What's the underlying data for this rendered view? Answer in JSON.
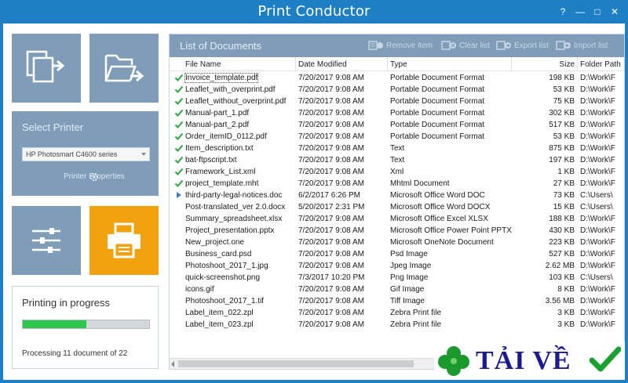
{
  "app": {
    "title": "Print Conductor",
    "help": "?",
    "minimize": "—",
    "maximize": "□",
    "close": "✕"
  },
  "left_panel": {
    "add_files_icon": "add-files-icon",
    "add_folder_icon": "add-folder-icon",
    "select_printer_label": "Select Printer",
    "printer_value": "HP Photosmart C4600 series",
    "printer_properties_label": "Printer Properties",
    "settings_icon": "sliders-icon",
    "print_icon": "printer-icon",
    "accent_color": "#f2a20f",
    "tile_color": "#7f9db8"
  },
  "progress": {
    "title": "Printing in progress",
    "fraction": 0.5,
    "status": "Processing 11 document of 22",
    "bar_color": "#2ec74d"
  },
  "documents": {
    "title": "List of Documents",
    "toolbar": {
      "remove_item": "Remove item",
      "clear_list": "Clear list",
      "export_list": "Export list",
      "import_list": "Import list"
    },
    "columns": {
      "name": "File Name",
      "date": "Date Modified",
      "type": "Type",
      "size": "Size",
      "path": "Folder Path"
    },
    "rows": [
      {
        "status": "done",
        "name": "Invoice_template.pdf",
        "date": "7/20/2017 9:08 AM",
        "type": "Portable Document Format",
        "size": "198 KB",
        "path": "D:\\Work\\F"
      },
      {
        "status": "done",
        "name": "Leaflet_with_overprint.pdf",
        "date": "7/20/2017 9:08 AM",
        "type": "Portable Document Format",
        "size": "53 KB",
        "path": "D:\\Work\\F"
      },
      {
        "status": "done",
        "name": "Leaflet_without_overprint.pdf",
        "date": "7/20/2017 9:08 AM",
        "type": "Portable Document Format",
        "size": "75 KB",
        "path": "D:\\Work\\F"
      },
      {
        "status": "done",
        "name": "Manual-part_1.pdf",
        "date": "7/20/2017 9:08 AM",
        "type": "Portable Document Format",
        "size": "302 KB",
        "path": "D:\\Work\\F"
      },
      {
        "status": "done",
        "name": "Manual-part_2.pdf",
        "date": "7/20/2017 9:08 AM",
        "type": "Portable Document Format",
        "size": "517 KB",
        "path": "D:\\Work\\F"
      },
      {
        "status": "done",
        "name": "Order_itemID_0112.pdf",
        "date": "7/20/2017 9:08 AM",
        "type": "Portable Document Format",
        "size": "53 KB",
        "path": "D:\\Work\\F"
      },
      {
        "status": "done",
        "name": "Item_description.txt",
        "date": "7/20/2017 9:08 AM",
        "type": "Text",
        "size": "875 KB",
        "path": "D:\\Work\\F"
      },
      {
        "status": "done",
        "name": "bat-ftpscript.txt",
        "date": "7/20/2017 9:08 AM",
        "type": "Text",
        "size": "197 KB",
        "path": "D:\\Work\\F"
      },
      {
        "status": "done",
        "name": "Framework_List.xml",
        "date": "7/20/2017 9:08 AM",
        "type": "Xml",
        "size": "1 KB",
        "path": "D:\\Work\\F"
      },
      {
        "status": "done",
        "name": "project_template.mht",
        "date": "7/20/2017 9:08 AM",
        "type": "Mhtml Document",
        "size": "27 KB",
        "path": "D:\\Work\\F"
      },
      {
        "status": "current",
        "name": "third-party-legal-notices.doc",
        "date": "6/2/2017 6:26 PM",
        "type": "Microsoft Office Word DOC",
        "size": "73 KB",
        "path": "C:\\Users\\"
      },
      {
        "status": "",
        "name": "Post-translated_ver 2.0.docx",
        "date": "5/20/2017 2:31 PM",
        "type": "Microsoft Office Word DOCX",
        "size": "15 KB",
        "path": "C:\\Users\\"
      },
      {
        "status": "",
        "name": "Summary_spreadsheet.xlsx",
        "date": "7/20/2017 9:08 AM",
        "type": "Microsoft Office Excel XLSX",
        "size": "188 KB",
        "path": "D:\\Work\\F"
      },
      {
        "status": "",
        "name": "Project_presentation.pptx",
        "date": "7/20/2017 9:08 AM",
        "type": "Microsoft Office Power Point PPTX",
        "size": "430 KB",
        "path": "D:\\Work\\F"
      },
      {
        "status": "",
        "name": "New_project.one",
        "date": "7/20/2017 9:08 AM",
        "type": "Microsoft OneNote Document",
        "size": "223 KB",
        "path": "D:\\Work\\F"
      },
      {
        "status": "",
        "name": "Business_card.psd",
        "date": "7/20/2017 9:08 AM",
        "type": "Psd Image",
        "size": "527 KB",
        "path": "D:\\Work\\F"
      },
      {
        "status": "",
        "name": "Photoshoot_2017_1.jpg",
        "date": "7/20/2017 9:08 AM",
        "type": "Jpeg Image",
        "size": "2.62 MB",
        "path": "D:\\Work\\F"
      },
      {
        "status": "",
        "name": "quick-screenshot.png",
        "date": "7/3/2017 10:20 PM",
        "type": "Png Image",
        "size": "103 KB",
        "path": "C:\\Users\\"
      },
      {
        "status": "",
        "name": "icons.gif",
        "date": "7/20/2017 9:08 AM",
        "type": "Gif Image",
        "size": "8 KB",
        "path": "D:\\Work\\F"
      },
      {
        "status": "",
        "name": "Photoshoot_2017_1.tif",
        "date": "7/20/2017 9:08 AM",
        "type": "Tiff Image",
        "size": "3.56 MB",
        "path": "D:\\Work\\F"
      },
      {
        "status": "",
        "name": "Label_item_022.zpl",
        "date": "7/20/2017 9:08 AM",
        "type": "Zebra Print file",
        "size": "3 KB",
        "path": "D:\\Work\\F"
      },
      {
        "status": "",
        "name": "Label_item_023.zpl",
        "date": "7/20/2017 9:08 AM",
        "type": "Zebra Print file",
        "size": "3 KB",
        "path": "D:\\Work\\F"
      }
    ]
  },
  "watermark": {
    "text": "TẢI VỀ",
    "clover_icon": "clover-icon",
    "check_icon": "check-icon"
  }
}
